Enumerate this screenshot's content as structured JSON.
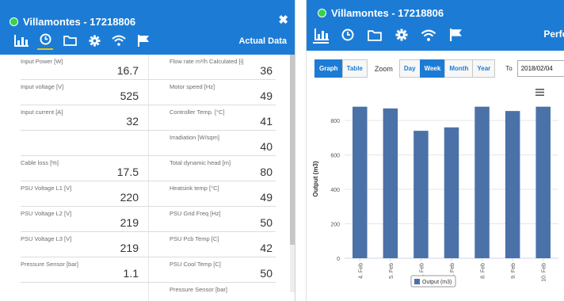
{
  "left": {
    "title": "Villamontes - 17218806",
    "close": "✖",
    "header_right": "Actual Data",
    "rows": [
      {
        "l_label": "Input Power [W]",
        "l_value": "16.7",
        "r_label": "Flow rate m³/h Calculated [i]",
        "r_value": "36"
      },
      {
        "l_label": "Input voltage [V]",
        "l_value": "525",
        "r_label": "Motor speed [Hz]",
        "r_value": "49"
      },
      {
        "l_label": "Input current [A]",
        "l_value": "32",
        "r_label": "Controller Temp. [°C]",
        "r_value": "41"
      },
      {
        "l_label": "",
        "l_value": "",
        "r_label": "Irradiation [W/sqm]",
        "r_value": "40"
      },
      {
        "l_label": "Cable loss [%]",
        "l_value": "17.5",
        "r_label": "Total dynamic head [m]",
        "r_value": "80"
      },
      {
        "l_label": "PSU Voltage L1 [V]",
        "l_value": "220",
        "r_label": "Heatsink temp [°C]",
        "r_value": "49"
      },
      {
        "l_label": "PSU Voltage L2 [V]",
        "l_value": "219",
        "r_label": "PSU Grid Freq [Hz]",
        "r_value": "50"
      },
      {
        "l_label": "PSU Voltage L3 [V]",
        "l_value": "219",
        "r_label": "PSU Pcb Temp [C]",
        "r_value": "42"
      },
      {
        "l_label": "Pressure Sensor [bar]",
        "l_value": "1.1",
        "r_label": "PSU Cool Temp [C]",
        "r_value": "50"
      },
      {
        "l_label": "",
        "l_value": "",
        "r_label": "Pressure Sensor [bar]",
        "r_value": ""
      }
    ]
  },
  "right": {
    "title": "Villamontes - 17218806",
    "header_right": "Perfo",
    "view_tabs": [
      "Graph",
      "Table"
    ],
    "zoom_label": "Zoom",
    "zoom_tabs": [
      "Day",
      "Week",
      "Month",
      "Year"
    ],
    "to_label": "To",
    "date_value": "2018/02/04"
  },
  "colors": {
    "brand": "#1c7cd5",
    "status": "#39d04a",
    "bar": "#4a72a8"
  },
  "chart_data": {
    "type": "bar",
    "categories": [
      "4. Feb",
      "5. Feb",
      "6. Feb",
      "7. Feb",
      "8. Feb",
      "9. Feb",
      "10. Feb"
    ],
    "series": [
      {
        "name": "Output (m3)",
        "values": [
          880,
          870,
          740,
          760,
          880,
          855,
          880
        ]
      }
    ],
    "ylabel": "Output (m3)",
    "yticks": [
      0,
      200,
      400,
      600,
      800
    ],
    "ylim": [
      0,
      920
    ],
    "legend": "bottom",
    "grid": true
  }
}
